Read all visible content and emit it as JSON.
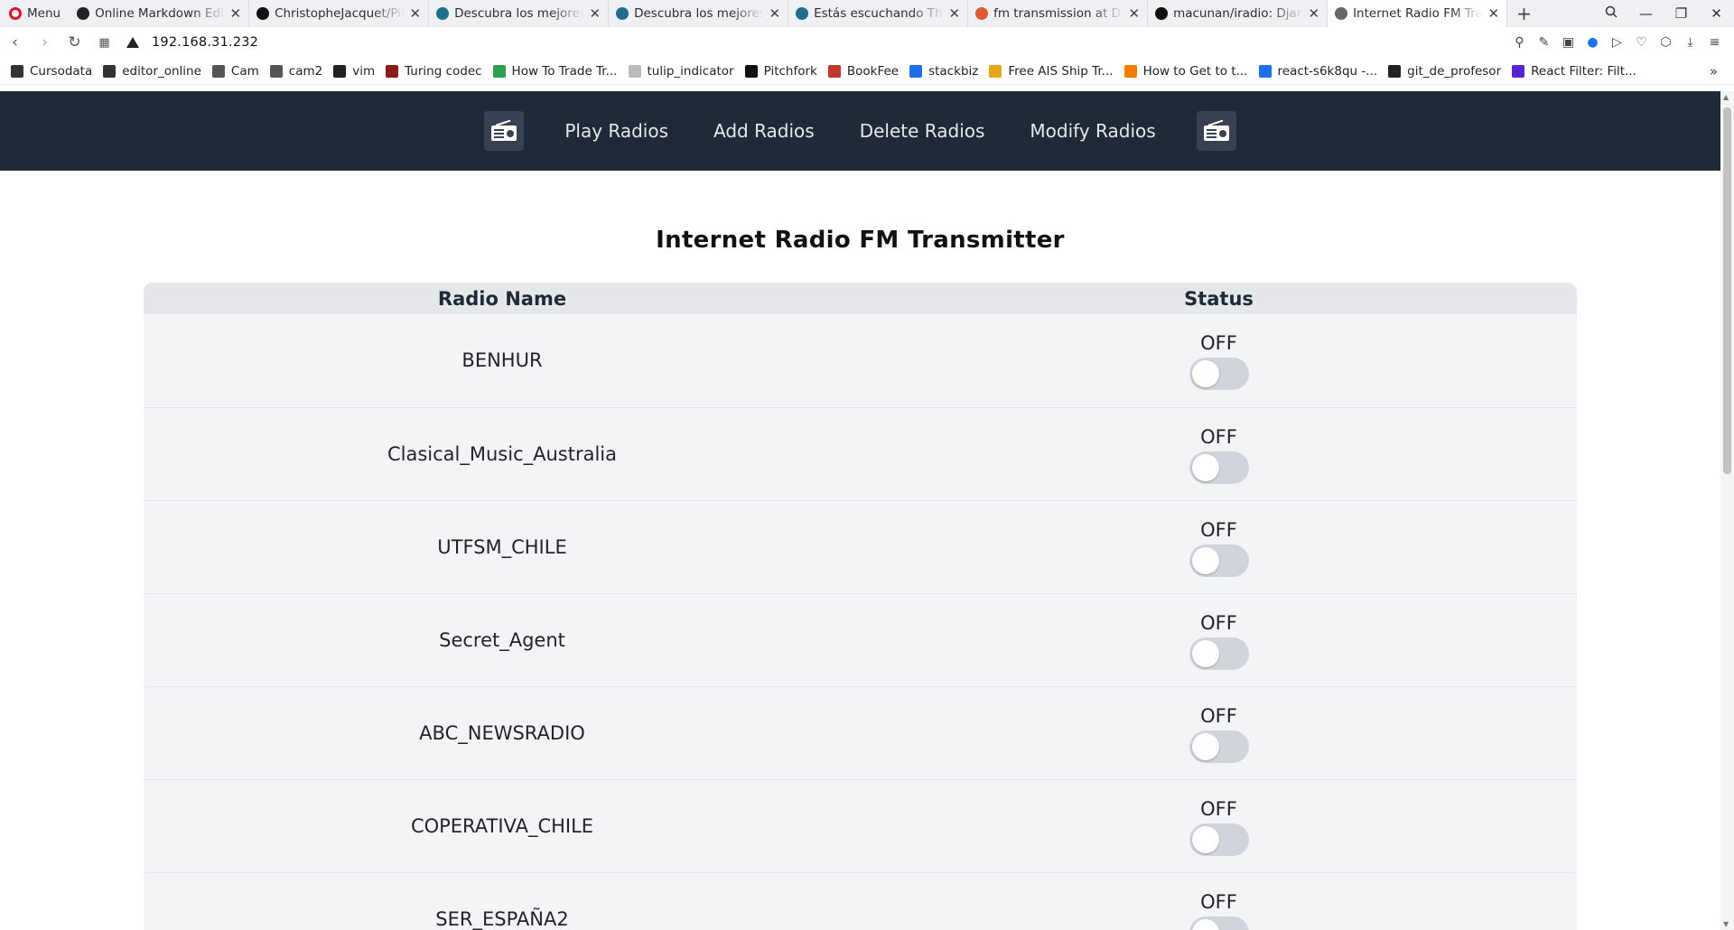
{
  "browser": {
    "menu_label": "Menu",
    "tabs": [
      {
        "title": "Online Markdown Edit",
        "favicon": "dillinger-icon",
        "color": "#222222"
      },
      {
        "title": "ChristopheJacquet/PiF",
        "favicon": "github-icon",
        "color": "#111111"
      },
      {
        "title": "Descubra los mejores",
        "favicon": "globe-icon",
        "color": "#1f6f8b"
      },
      {
        "title": "Descubra los mejores",
        "favicon": "globe-icon",
        "color": "#1f6f8b"
      },
      {
        "title": "Estás escuchando The",
        "favicon": "globe-icon",
        "color": "#1f6f8b"
      },
      {
        "title": "fm transmission at Du",
        "favicon": "duckduckgo-icon",
        "color": "#de5833"
      },
      {
        "title": "macunan/iradio: Djan",
        "favicon": "github-icon",
        "color": "#111111"
      },
      {
        "title": "Internet Radio FM Tran",
        "favicon": "document-icon",
        "color": "#666666",
        "active": true
      }
    ],
    "url": "192.168.31.232",
    "bookmarks": [
      {
        "label": "Cursodata",
        "icon": "cursodata-icon"
      },
      {
        "label": "editor_online",
        "icon": "editor-icon"
      },
      {
        "label": "Cam",
        "icon": "file-icon"
      },
      {
        "label": "cam2",
        "icon": "file-icon"
      },
      {
        "label": "vim",
        "icon": "github-icon"
      },
      {
        "label": "Turing codec",
        "icon": "turing-icon"
      },
      {
        "label": "How To Trade Tr...",
        "icon": "trade-icon"
      },
      {
        "label": "tulip_indicator",
        "icon": "tulip-icon"
      },
      {
        "label": "Pitchfork",
        "icon": "pitchfork-icon"
      },
      {
        "label": "BookFee",
        "icon": "bookfee-icon"
      },
      {
        "label": "stackbiz",
        "icon": "bolt-icon"
      },
      {
        "label": "Free AIS Ship Tr...",
        "icon": "ais-icon"
      },
      {
        "label": "How to Get to t...",
        "icon": "blogger-icon"
      },
      {
        "label": "react-s6k8qu -...",
        "icon": "bolt-icon"
      },
      {
        "label": "git_de_profesor",
        "icon": "github-icon"
      },
      {
        "label": "React Filter: Filt...",
        "icon": "udemy-icon"
      }
    ]
  },
  "nav": {
    "links": [
      "Play Radios",
      "Add Radios",
      "Delete Radios",
      "Modify Radios"
    ]
  },
  "page": {
    "title": "Internet Radio FM Transmitter",
    "table": {
      "headers": [
        "Radio Name",
        "Status"
      ],
      "rows": [
        {
          "name": "BENHUR",
          "status": "OFF",
          "on": false
        },
        {
          "name": "Clasical_Music_Australia",
          "status": "OFF",
          "on": false
        },
        {
          "name": "UTFSM_CHILE",
          "status": "OFF",
          "on": false
        },
        {
          "name": "Secret_Agent",
          "status": "OFF",
          "on": false
        },
        {
          "name": "ABC_NEWSRADIO",
          "status": "OFF",
          "on": false
        },
        {
          "name": "COPERATIVA_CHILE",
          "status": "OFF",
          "on": false
        },
        {
          "name": "SER_ESPAÑA2",
          "status": "OFF",
          "on": false
        }
      ]
    }
  },
  "colors": {
    "navbar_bg": "#1f2937",
    "table_header_bg": "#e5e7eb",
    "row_bg": "#f3f4f6",
    "toggle_off": "#d1d5db"
  }
}
